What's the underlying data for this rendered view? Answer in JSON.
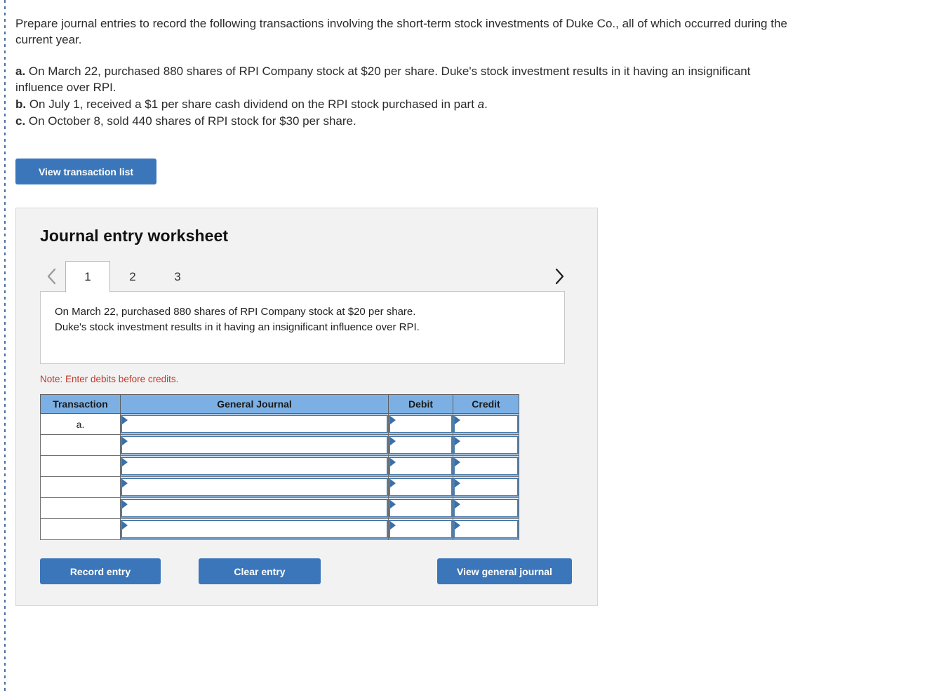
{
  "problem": {
    "intro": "Prepare journal entries to record the following transactions involving the short-term stock investments of Duke Co., all of which occurred during the current year.",
    "items": [
      {
        "label": "a.",
        "text_before": " On March 22, purchased 880 shares of RPI Company stock at $20 per share. Duke's stock investment results in it having an insignificant influence over RPI.",
        "italic": "",
        "text_after": ""
      },
      {
        "label": "b.",
        "text_before": " On July 1, received a $1 per share cash dividend on the RPI stock purchased in part ",
        "italic": "a",
        "text_after": "."
      },
      {
        "label": "c.",
        "text_before": " On October 8, sold 440 shares of RPI stock for $30 per share.",
        "italic": "",
        "text_after": ""
      }
    ]
  },
  "actions": {
    "view_transaction_list": "View transaction list",
    "record_entry": "Record entry",
    "clear_entry": "Clear entry",
    "view_general_journal": "View general journal"
  },
  "worksheet": {
    "title": "Journal entry worksheet",
    "prev_icon": "chevron-left-icon",
    "next_icon": "chevron-right-icon",
    "tabs": [
      {
        "label": "1",
        "active": true
      },
      {
        "label": "2",
        "active": false
      },
      {
        "label": "3",
        "active": false
      }
    ],
    "description_line1": "On March 22, purchased 880 shares of RPI Company stock at $20 per share.",
    "description_line2": "Duke's stock investment results in it having an insignificant influence over RPI.",
    "note": "Note: Enter debits before credits.",
    "table": {
      "headers": [
        "Transaction",
        "General Journal",
        "Debit",
        "Credit"
      ],
      "rows": [
        {
          "transaction": "a.",
          "general_journal": "",
          "debit": "",
          "credit": ""
        },
        {
          "transaction": "",
          "general_journal": "",
          "debit": "",
          "credit": ""
        },
        {
          "transaction": "",
          "general_journal": "",
          "debit": "",
          "credit": ""
        },
        {
          "transaction": "",
          "general_journal": "",
          "debit": "",
          "credit": ""
        },
        {
          "transaction": "",
          "general_journal": "",
          "debit": "",
          "credit": ""
        },
        {
          "transaction": "",
          "general_journal": "",
          "debit": "",
          "credit": ""
        }
      ]
    }
  },
  "colors": {
    "primary_button": "#3b76ba",
    "table_header": "#7cb0e4",
    "note_text": "#c0392b",
    "panel_background": "#f2f2f2",
    "select_border": "#4a7fb5"
  }
}
